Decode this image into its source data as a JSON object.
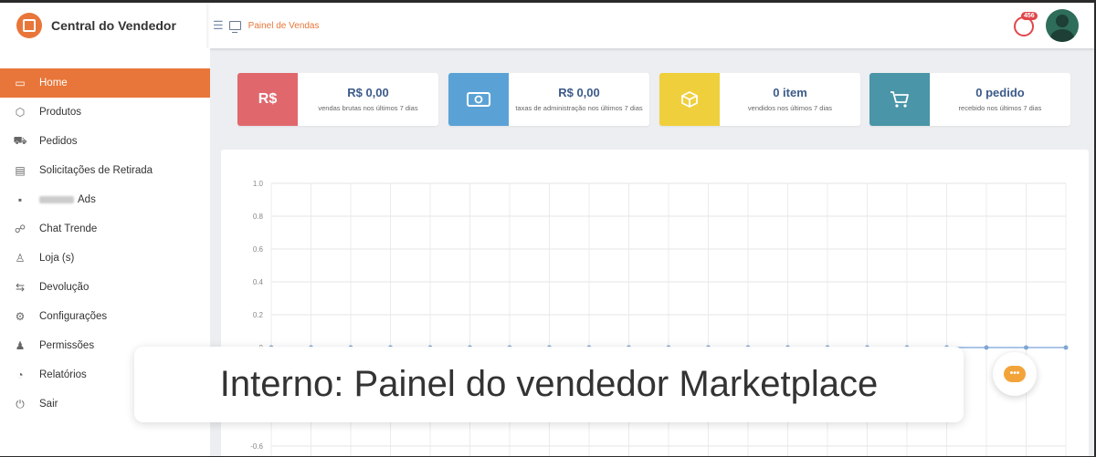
{
  "header": {
    "brand": "Central do Vendedor",
    "breadcrumb": "Painel de Vendas",
    "notification_count": "456"
  },
  "sidebar": {
    "items": [
      {
        "label": "Home",
        "icon": "monitor-icon",
        "active": true
      },
      {
        "label": "Produtos",
        "icon": "box-icon"
      },
      {
        "label": "Pedidos",
        "icon": "cart-icon"
      },
      {
        "label": "Solicitações de Retirada",
        "icon": "card-icon"
      },
      {
        "label": "Ads",
        "icon": "ads-icon",
        "blurred_prefix": true
      },
      {
        "label": "Chat Trende",
        "icon": "chat-icon"
      },
      {
        "label": "Loja (s)",
        "icon": "user-icon"
      },
      {
        "label": "Devolução",
        "icon": "return-icon"
      },
      {
        "label": "Configurações",
        "icon": "settings-icon"
      },
      {
        "label": "Permissões",
        "icon": "permission-icon"
      },
      {
        "label": "Relatórios",
        "icon": "report-icon"
      },
      {
        "label": "Sair",
        "icon": "power-icon"
      }
    ]
  },
  "stats": [
    {
      "icon_text": "R$",
      "value": "R$ 0,00",
      "label": "vendas brutas nos últimos 7 dias",
      "color": "#e0686d",
      "icon": "currency-icon"
    },
    {
      "icon_text": "",
      "value": "R$ 0,00",
      "label": "taxas de administração nos últimos 7 dias",
      "color": "#5aa2d6",
      "icon": "cash-icon"
    },
    {
      "icon_text": "",
      "value": "0 item",
      "label": "vendidos nos últimos 7 dias",
      "color": "#f0cf3c",
      "icon": "package-icon"
    },
    {
      "icon_text": "",
      "value": "0 pedido",
      "label": "recebido nos últimos 7 dias",
      "color": "#4a95a8",
      "icon": "cart-icon"
    }
  ],
  "chart_data": {
    "type": "line",
    "title": "",
    "xlabel": "",
    "ylabel": "",
    "y_ticks": [
      "1.0",
      "0.8",
      "0.6",
      "0.4",
      "0.2",
      "0",
      "-0.6"
    ],
    "ylim": [
      -0.6,
      1.0
    ],
    "grid": true,
    "series": [
      {
        "values": [
          0,
          0,
          0,
          0,
          0,
          0,
          0,
          0,
          0,
          0,
          0,
          0,
          0,
          0,
          0,
          0,
          0,
          0,
          0,
          0,
          0
        ],
        "color": "#8fb4df"
      }
    ]
  },
  "caption": "Interno: Painel do vendedor Marketplace"
}
